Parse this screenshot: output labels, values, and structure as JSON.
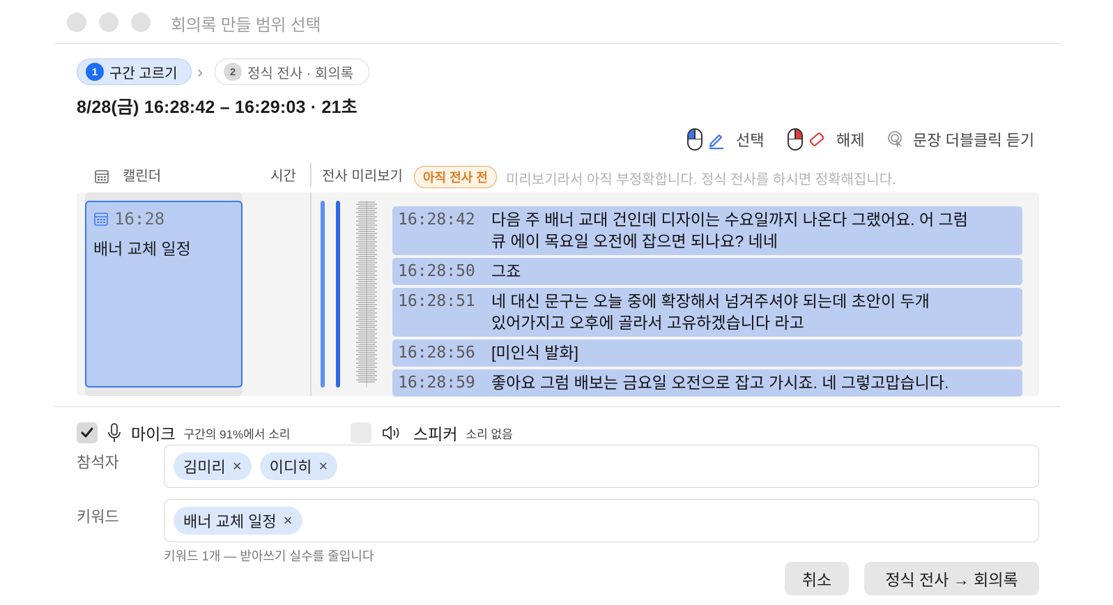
{
  "window": {
    "title": "회의록 만들 범위 선택"
  },
  "steps": [
    {
      "num": "1",
      "label": "구간 고르기",
      "active": true
    },
    {
      "num": "2",
      "label": "정식 전사 · 회의록",
      "active": false
    }
  ],
  "range_label": "8/28(금) 16:28:42 – 16:29:03 · 21초",
  "legend": {
    "select": "선택",
    "deselect": "해제",
    "double_click": "문장 더블클릭 듣기"
  },
  "columns": {
    "calendar": "캘린더",
    "time": "시간",
    "preview": "전사 미리보기",
    "badge": "아직 전사 전",
    "hint": "미리보기라서 아직 부정확합니다. 정식 전사를 하시면 정확해집니다."
  },
  "calendar_event": {
    "time": "16:28",
    "title": "배너 교체 일정"
  },
  "transcript": [
    {
      "time": "16:28:42",
      "text_line1": "다음 주 배너 교대 건인데 디자이는 수요일까지 나온다 그랬어요. 어 그럼",
      "text_line2": "큐 에이 목요일 오전에 잡으면 되나요? 네네"
    },
    {
      "time": "16:28:50",
      "text_line1": "그죠",
      "text_line2": ""
    },
    {
      "time": "16:28:51",
      "text_line1": "네 대신 문구는 오늘 중에 확장해서 넘겨주셔야 되는데 초안이 두개",
      "text_line2": "있어가지고 오후에 골라서 고유하겠습니다 라고"
    },
    {
      "time": "16:28:56",
      "text_line1": "[미인식 발화]",
      "text_line2": ""
    },
    {
      "time": "16:28:59",
      "text_line1": "좋아요 그럼 배보는 금요일 오전으로 잡고 가시죠. 네 그렇고맙습니다.",
      "text_line2": ""
    }
  ],
  "sources": {
    "mic": {
      "label": "마이크",
      "sub": "구간의 91%에서 소리",
      "checked": true
    },
    "speaker": {
      "label": "스피커",
      "sub": "소리 없음",
      "checked": false
    }
  },
  "participants": {
    "label": "참석자",
    "chips": [
      "김미리",
      "이디히"
    ]
  },
  "keywords": {
    "label": "키워드",
    "chips": [
      "배너 교체 일정"
    ],
    "hint": "키워드 1개 — 받아쓰기 실수를 줄입니다"
  },
  "buttons": {
    "cancel": "취소",
    "confirm": "정식 전사 → 회의록"
  },
  "remove_glyph": "×",
  "colors": {
    "accent": "#1d6ef2",
    "selection": "#bccdf2",
    "badge_orange": "#e07a1f",
    "eraser_red": "#e23b3b"
  }
}
